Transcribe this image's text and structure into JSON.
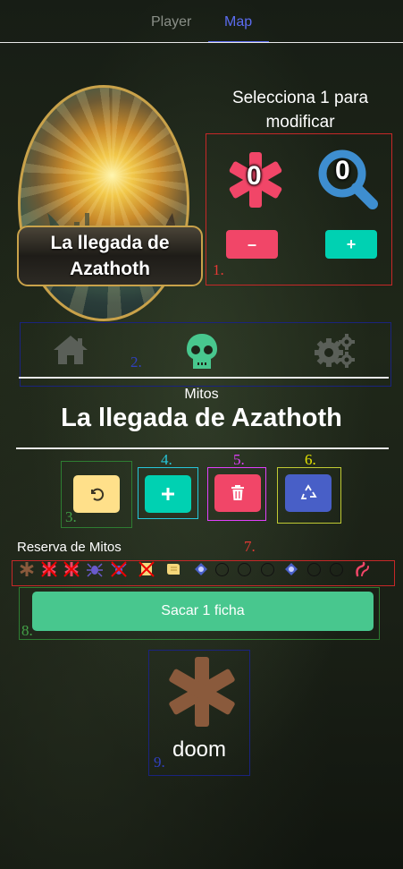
{
  "tabs": [
    {
      "label": "Player",
      "active": false
    },
    {
      "label": "Map",
      "active": true
    }
  ],
  "scenario_card": {
    "title": "La llegada de Azathoth"
  },
  "counters": {
    "instruction": "Selecciona 1 para modificar",
    "doom_value": "0",
    "clue_value": "0",
    "decrement_label": "–",
    "increment_label": "+",
    "doom_icon": "asterisk-icon",
    "clue_icon": "magnifier-icon"
  },
  "nav": {
    "items": [
      {
        "icon": "home-icon",
        "active": false
      },
      {
        "icon": "skull-icon",
        "active": true
      },
      {
        "icon": "gears-icon",
        "active": false
      }
    ]
  },
  "mythos": {
    "label": "Mitos",
    "title": "La llegada de Azathoth"
  },
  "actions": [
    {
      "icon": "undo-icon",
      "color": "#ffe08a"
    },
    {
      "icon": "plus-icon",
      "color": "#00d1b2"
    },
    {
      "icon": "trash-icon",
      "color": "#f14668"
    },
    {
      "icon": "recycle-icon",
      "color": "#485fc7"
    }
  ],
  "reserve": {
    "label": "Reserva de Mitos",
    "tokens": [
      "doom",
      "doom-crossed",
      "doom-crossed",
      "spider",
      "spider-crossed",
      "scroll-crossed",
      "scroll",
      "portal",
      "empty",
      "empty",
      "empty",
      "portal",
      "empty",
      "empty",
      "tentacle"
    ]
  },
  "draw_button_label": "Sacar 1 ficha",
  "drawn": {
    "icon": "asterisk-icon",
    "label": "doom"
  },
  "annotations": [
    "1.",
    "2.",
    "3.",
    "4.",
    "5.",
    "6.",
    "7.",
    "8.",
    "9."
  ],
  "colors": {
    "accent": "#5b6cf0",
    "doom": "#f14668",
    "clue": "#3e8ed0",
    "increment": "#00d1b2",
    "success": "#48c78e",
    "drawn_doom": "#8a5a3c"
  }
}
